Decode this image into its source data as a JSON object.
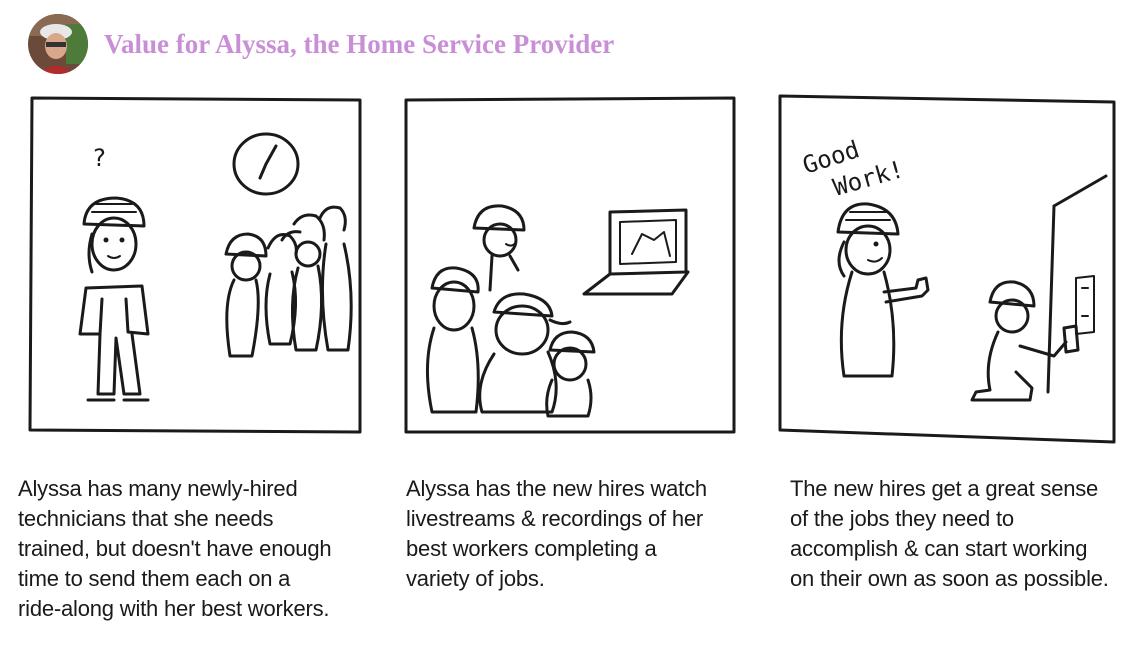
{
  "header": {
    "title": "Value for Alyssa, the Home Service Provider"
  },
  "panels": [
    {
      "caption_lines": [
        "Alyssa has many newly-hired",
        "technicians that she needs",
        "trained, but doesn't have enough",
        "time to send them each on a",
        "ride-along with her best workers."
      ],
      "thought_mark": "?"
    },
    {
      "caption_lines": [
        "Alyssa has the new hires watch",
        "livestreams & recordings of her",
        "best workers completing a",
        "variety of jobs."
      ]
    },
    {
      "caption_lines": [
        "The new hires get a great sense",
        "of the jobs they need to",
        "accomplish & can start working",
        "on their own as soon as possible."
      ],
      "speech": [
        "Good",
        "Work!"
      ]
    }
  ],
  "colors": {
    "title": "#c98fd6",
    "ink": "#1a1a1a"
  }
}
